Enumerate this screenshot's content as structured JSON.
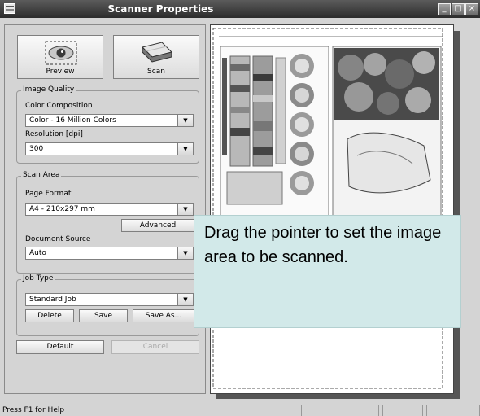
{
  "window": {
    "title": "Scanner Properties",
    "min": "_",
    "max": "□",
    "close": "×"
  },
  "toolbar": {
    "preview_label": "Preview",
    "scan_label": "Scan"
  },
  "image_quality": {
    "group_label": "Image Quality",
    "color_label": "Color Composition",
    "color_value": "Color - 16 Million Colors",
    "resolution_label": "Resolution [dpi]",
    "resolution_value": "300"
  },
  "scan_area": {
    "group_label": "Scan Area",
    "page_format_label": "Page Format",
    "page_format_value": "A4 - 210x297 mm",
    "advanced_label": "Advanced",
    "source_label": "Document Source",
    "source_value": "Auto"
  },
  "job_type": {
    "group_label": "Job Type",
    "job_value": "Standard Job",
    "delete_label": "Delete",
    "save_label": "Save",
    "save_as_label": "Save As..."
  },
  "footer": {
    "default_label": "Default",
    "cancel_label": "Cancel"
  },
  "status": {
    "text": "Press F1 for Help"
  },
  "callout": {
    "text": "Drag the pointer to set the image area to be scanned."
  }
}
